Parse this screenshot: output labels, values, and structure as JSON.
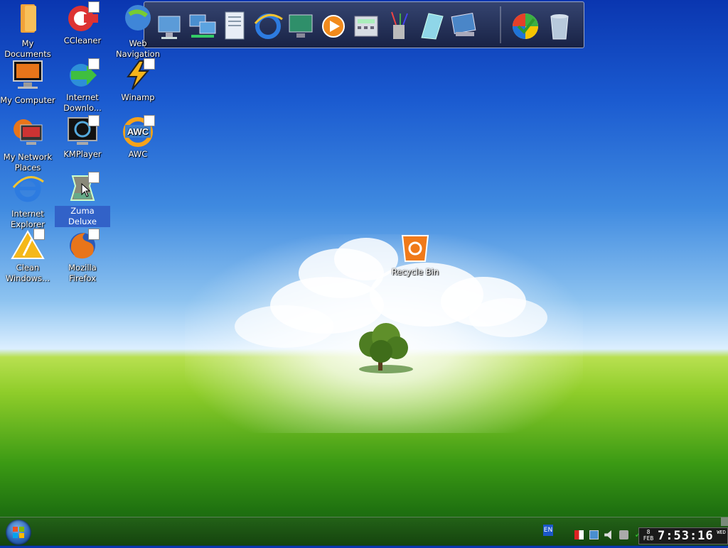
{
  "desktop_icons": [
    {
      "label": "My Documents",
      "icon": "folder-icon"
    },
    {
      "label": "CCleaner",
      "icon": "ccleaner-icon"
    },
    {
      "label": "Web Navigation",
      "icon": "globe-icon"
    },
    {
      "label": "My Computer",
      "icon": "computer-icon"
    },
    {
      "label": "Internet Downlo...",
      "icon": "download-manager-icon"
    },
    {
      "label": "Winamp",
      "icon": "winamp-icon"
    },
    {
      "label": "My Network Places",
      "icon": "network-icon"
    },
    {
      "label": "KMPlayer",
      "icon": "kmplayer-icon"
    },
    {
      "label": "AWC",
      "icon": "awc-icon",
      "text": "AWC"
    },
    {
      "label": "Internet Explorer",
      "icon": "ie-icon"
    },
    {
      "label": "Zuma Deluxe",
      "icon": "zuma-icon"
    },
    {
      "label": "Clean Windows...",
      "icon": "clean-windows-icon"
    },
    {
      "label": "Mozilla Firefox",
      "icon": "firefox-icon"
    },
    {
      "label": "Recycle Bin",
      "icon": "recycle-bin-icon"
    }
  ],
  "dock_items": [
    "computer-icon",
    "network-icon",
    "documents-icon",
    "ie-icon",
    "display-icon",
    "media-player-icon",
    "calculator-icon",
    "paint-icon",
    "notepad-icon",
    "settings-icon",
    "windows-icon",
    "trash-icon"
  ],
  "taskbar": {
    "language": "EN",
    "clock": {
      "day": "8",
      "month": "FEB",
      "time": "7:53:16",
      "weekday": "WED"
    }
  },
  "colors": {
    "selection": "#3262c8",
    "dock_border": "#9aa6c4"
  }
}
